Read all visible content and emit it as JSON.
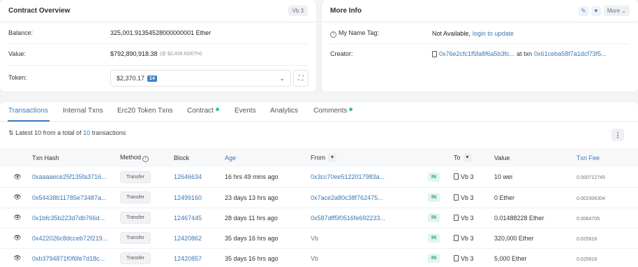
{
  "overview": {
    "title": "Contract Overview",
    "chip": "Vb 3",
    "balance_label": "Balance:",
    "balance_value": "325,001.91354528000000001 Ether",
    "value_label": "Value:",
    "value_value": "$792,890,918.38",
    "value_rate": "(@ $2,439.65/ETH)",
    "token_label": "Token:",
    "token_value": "$2,370.17",
    "token_count": "14"
  },
  "moreinfo": {
    "title": "More Info",
    "more_label": "More",
    "nametag_label": "My Name Tag:",
    "nametag_value": "Not Available,",
    "nametag_link": "login to update",
    "creator_label": "Creator:",
    "creator_address": "0x76e2cfc1f5fa8f6a5b3fc...",
    "creator_at": "at txn",
    "creator_txn": "0x61ceba58f7a1dcf73f5..."
  },
  "tabs": [
    "Transactions",
    "Internal Txns",
    "Erc20 Token Txns",
    "Contract",
    "Events",
    "Analytics",
    "Comments"
  ],
  "summary": {
    "prefix": "Latest 10 from a total of",
    "count": "10",
    "suffix": "transactions"
  },
  "table": {
    "headers": {
      "hash": "Txn Hash",
      "method": "Method",
      "block": "Block",
      "age": "Age",
      "from": "From",
      "to": "To",
      "value": "Value",
      "fee": "Txn Fee"
    },
    "rows": [
      {
        "hash": "0xaaaaece25f135fa3716...",
        "method": "Transfer",
        "block": "12646634",
        "age": "16 hrs 49 mins ago",
        "from": "0x3cc70ee5122017983a...",
        "dir": "IN",
        "to": "Vb 3",
        "value": "10 wei",
        "fee": "0.000712745"
      },
      {
        "hash": "0x54438b11785e73487a...",
        "method": "Transfer",
        "block": "12499160",
        "age": "23 days 13 hrs ago",
        "from": "0x7ace2a80c38f762475...",
        "dir": "IN",
        "to": "Vb 3",
        "value": "0 Ether",
        "fee": "0.002306304"
      },
      {
        "hash": "0x1bfc35b223d7db766d...",
        "method": "Transfer",
        "block": "12467445",
        "age": "28 days 11 hrs ago",
        "from": "0x587dff5f0516fe692233...",
        "dir": "IN",
        "to": "Vb 3",
        "value": "0.01488228 Ether",
        "fee": "0.0064705"
      },
      {
        "hash": "0x422026c8dcceb72f219...",
        "method": "Transfer",
        "block": "12420862",
        "age": "35 days 16 hrs ago",
        "from": "Vb",
        "dir": "IN",
        "to": "Vb 3",
        "value": "320,000 Ether",
        "fee": "0.025918"
      },
      {
        "hash": "0xb3794871f0f6fe7d18c...",
        "method": "Transfer",
        "block": "12420857",
        "age": "35 days 16 hrs ago",
        "from": "Vb",
        "dir": "IN",
        "to": "Vb 3",
        "value": "5,000 Ether",
        "fee": "0.025918"
      }
    ]
  },
  "colors": {
    "link": "#3a78b5",
    "in_badge": "#dff6ec",
    "status_dot": "#3cc28a"
  }
}
